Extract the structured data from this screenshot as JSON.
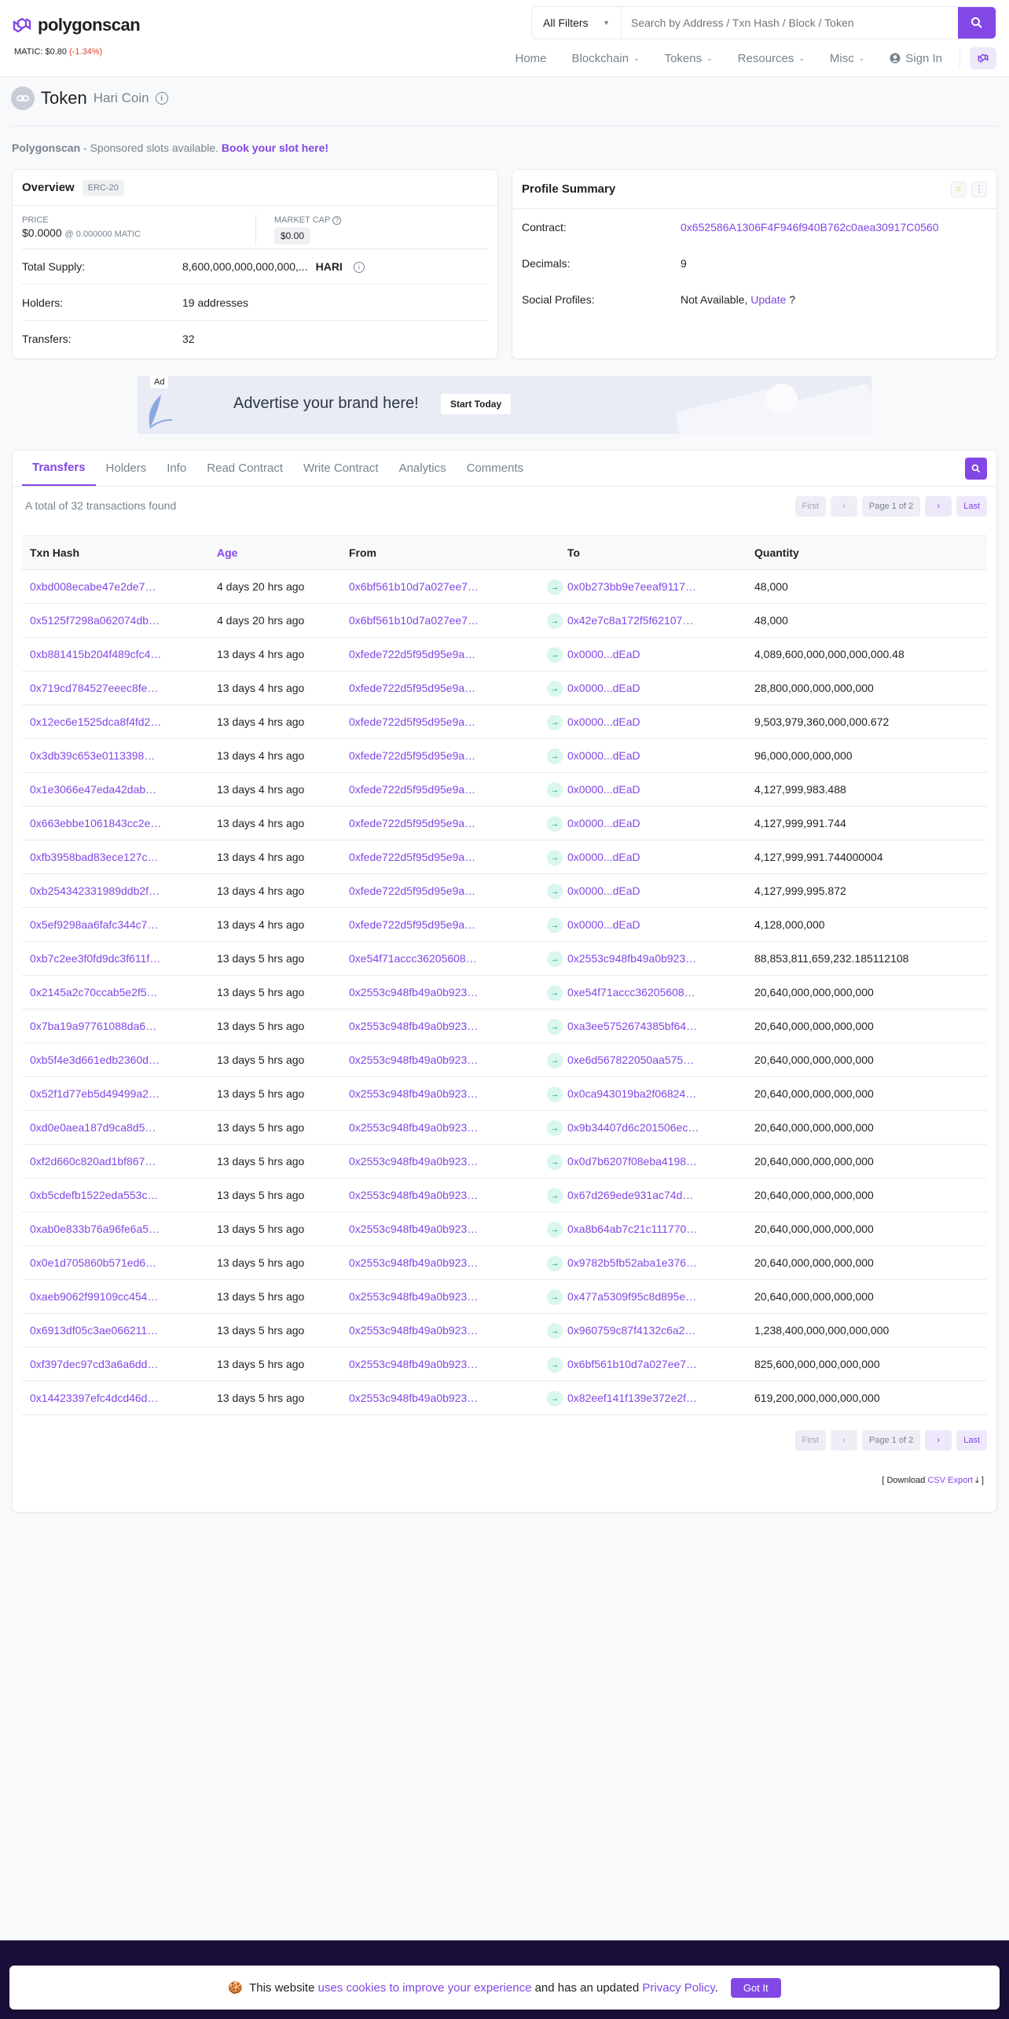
{
  "header": {
    "brand": "polygonscan",
    "price_label": "MATIC: $0.80",
    "price_change": "(-1.34%)",
    "filter": "All Filters",
    "search_placeholder": "Search by Address / Txn Hash / Block / Token",
    "nav": [
      "Home",
      "Blockchain",
      "Tokens",
      "Resources",
      "Misc"
    ],
    "sign_in": "Sign In"
  },
  "title": {
    "main": "Token",
    "sub": "Hari Coin"
  },
  "sponsor": {
    "brand": "Polygonscan",
    "text": " - Sponsored slots available. ",
    "link": "Book your slot here!"
  },
  "overview": {
    "title": "Overview",
    "badge": "ERC-20",
    "price_label": "PRICE",
    "price_value": "$0.0000",
    "price_matic": "@ 0.000000 MATIC",
    "cap_label": "MARKET CAP",
    "cap_value": "$0.00",
    "rows": [
      {
        "k": "Total Supply:",
        "v": "8,600,000,000,000,000,...",
        "extra": "HARI"
      },
      {
        "k": "Holders:",
        "v": "19 addresses"
      },
      {
        "k": "Transfers:",
        "v": "32"
      }
    ]
  },
  "profile": {
    "title": "Profile Summary",
    "contract_label": "Contract:",
    "contract": "0x652586A1306F4F946f940B762c0aea30917C0560",
    "decimals_label": "Decimals:",
    "decimals": "9",
    "social_label": "Social Profiles:",
    "social_value": "Not Available, ",
    "social_link": "Update",
    "social_q": " ?"
  },
  "ad": {
    "tag": "Ad",
    "text": "Advertise your brand here!",
    "button": "Start Today"
  },
  "tabs": [
    "Transfers",
    "Holders",
    "Info",
    "Read Contract",
    "Write Contract",
    "Analytics",
    "Comments"
  ],
  "transfers": {
    "total": "A total of 32 transactions found",
    "pager": {
      "first": "First",
      "prev": "‹",
      "page": "Page 1 of 2",
      "next": "›",
      "last": "Last"
    },
    "headers": [
      "Txn Hash",
      "Age",
      "From",
      "To",
      "Quantity"
    ],
    "rows": [
      [
        "0xbd008ecabe47e2de7…",
        "4 days 20 hrs ago",
        "0x6bf561b10d7a027ee7…",
        "0x0b273bb9e7eeaf9117…",
        "48,000"
      ],
      [
        "0x5125f7298a062074db…",
        "4 days 20 hrs ago",
        "0x6bf561b10d7a027ee7…",
        "0x42e7c8a172f5f62107…",
        "48,000"
      ],
      [
        "0xb881415b204f489cfc4…",
        "13 days 4 hrs ago",
        "0xfede722d5f95d95e9a…",
        "0x0000...dEaD",
        "4,089,600,000,000,000,000.48"
      ],
      [
        "0x719cd784527eeec8fe…",
        "13 days 4 hrs ago",
        "0xfede722d5f95d95e9a…",
        "0x0000...dEaD",
        "28,800,000,000,000,000"
      ],
      [
        "0x12ec6e1525dca8f4fd2…",
        "13 days 4 hrs ago",
        "0xfede722d5f95d95e9a…",
        "0x0000...dEaD",
        "9,503,979,360,000,000.672"
      ],
      [
        "0x3db39c653e0113398…",
        "13 days 4 hrs ago",
        "0xfede722d5f95d95e9a…",
        "0x0000...dEaD",
        "96,000,000,000,000"
      ],
      [
        "0x1e3066e47eda42dab…",
        "13 days 4 hrs ago",
        "0xfede722d5f95d95e9a…",
        "0x0000...dEaD",
        "4,127,999,983.488"
      ],
      [
        "0x663ebbe1061843cc2e…",
        "13 days 4 hrs ago",
        "0xfede722d5f95d95e9a…",
        "0x0000...dEaD",
        "4,127,999,991.744"
      ],
      [
        "0xfb3958bad83ece127c…",
        "13 days 4 hrs ago",
        "0xfede722d5f95d95e9a…",
        "0x0000...dEaD",
        "4,127,999,991.744000004"
      ],
      [
        "0xb254342331989ddb2f…",
        "13 days 4 hrs ago",
        "0xfede722d5f95d95e9a…",
        "0x0000...dEaD",
        "4,127,999,995.872"
      ],
      [
        "0x5ef9298aa6fafc344c7…",
        "13 days 4 hrs ago",
        "0xfede722d5f95d95e9a…",
        "0x0000...dEaD",
        "4,128,000,000"
      ],
      [
        "0xb7c2ee3f0fd9dc3f611f…",
        "13 days 5 hrs ago",
        "0xe54f71accc36205608…",
        "0x2553c948fb49a0b923…",
        "88,853,811,659,232.185112108"
      ],
      [
        "0x2145a2c70ccab5e2f5…",
        "13 days 5 hrs ago",
        "0x2553c948fb49a0b923…",
        "0xe54f71accc36205608…",
        "20,640,000,000,000,000"
      ],
      [
        "0x7ba19a97761088da6…",
        "13 days 5 hrs ago",
        "0x2553c948fb49a0b923…",
        "0xa3ee5752674385bf64…",
        "20,640,000,000,000,000"
      ],
      [
        "0xb5f4e3d661edb2360d…",
        "13 days 5 hrs ago",
        "0x2553c948fb49a0b923…",
        "0xe6d567822050aa575…",
        "20,640,000,000,000,000"
      ],
      [
        "0x52f1d77eb5d49499a2…",
        "13 days 5 hrs ago",
        "0x2553c948fb49a0b923…",
        "0x0ca943019ba2f06824…",
        "20,640,000,000,000,000"
      ],
      [
        "0xd0e0aea187d9ca8d5…",
        "13 days 5 hrs ago",
        "0x2553c948fb49a0b923…",
        "0x9b34407d6c201506ec…",
        "20,640,000,000,000,000"
      ],
      [
        "0xf2d660c820ad1bf867…",
        "13 days 5 hrs ago",
        "0x2553c948fb49a0b923…",
        "0x0d7b6207f08eba4198…",
        "20,640,000,000,000,000"
      ],
      [
        "0xb5cdefb1522eda553c…",
        "13 days 5 hrs ago",
        "0x2553c948fb49a0b923…",
        "0x67d269ede931ac74d…",
        "20,640,000,000,000,000"
      ],
      [
        "0xab0e833b76a96fe6a5…",
        "13 days 5 hrs ago",
        "0x2553c948fb49a0b923…",
        "0xa8b64ab7c21c111770…",
        "20,640,000,000,000,000"
      ],
      [
        "0x0e1d705860b571ed6…",
        "13 days 5 hrs ago",
        "0x2553c948fb49a0b923…",
        "0x9782b5fb52aba1e376…",
        "20,640,000,000,000,000"
      ],
      [
        "0xaeb9062f99109cc454…",
        "13 days 5 hrs ago",
        "0x2553c948fb49a0b923…",
        "0x477a5309f95c8d895e…",
        "20,640,000,000,000,000"
      ],
      [
        "0x6913df05c3ae066211…",
        "13 days 5 hrs ago",
        "0x2553c948fb49a0b923…",
        "0x960759c87f4132c6a2…",
        "1,238,400,000,000,000,000"
      ],
      [
        "0xf397dec97cd3a6a6dd…",
        "13 days 5 hrs ago",
        "0x2553c948fb49a0b923…",
        "0x6bf561b10d7a027ee7…",
        "825,600,000,000,000,000"
      ],
      [
        "0x14423397efc4dcd46d…",
        "13 days 5 hrs ago",
        "0x2553c948fb49a0b923…",
        "0x82eef141f139e372e2f…",
        "619,200,000,000,000,000"
      ]
    ],
    "csv": {
      "prefix": "[ Download ",
      "link": "CSV Export",
      "suffix": " ]"
    }
  },
  "cookie": {
    "text1": "This website ",
    "link1": "uses cookies to improve your experience",
    "text2": " and has an updated ",
    "link2": "Privacy Policy",
    "text3": ".",
    "button": "Got It"
  }
}
